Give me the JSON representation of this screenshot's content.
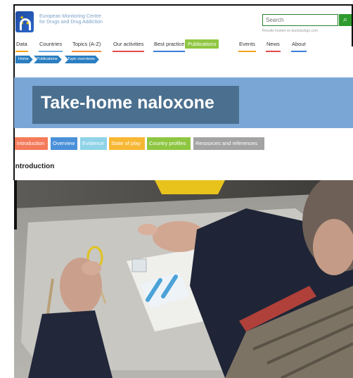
{
  "header": {
    "org_name_line1": "European Monitoring Centre",
    "org_name_line2": "for Drugs and Drug Addiction",
    "search_placeholder": "Search",
    "search_hint": "Results hosted on duckduckgo.com"
  },
  "nav": {
    "items": [
      {
        "label": "Data",
        "color": "#f4a21a"
      },
      {
        "label": "Countries",
        "color": "#6aa8e0"
      },
      {
        "label": "Topics (A-Z)",
        "color": "#f08a3c"
      },
      {
        "label": "Our activities",
        "color": "#e54b4b"
      },
      {
        "label": "Best practice",
        "color": "#3b7dd8"
      },
      {
        "label": "Publications",
        "color": "#8ec641"
      },
      {
        "label": "Events",
        "color": "#f4a21a"
      },
      {
        "label": "News",
        "color": "#e54b4b"
      },
      {
        "label": "About",
        "color": "#3b7dd8"
      }
    ]
  },
  "breadcrumb": [
    "Home",
    "Publications",
    "Topic overviews"
  ],
  "page_title": "Take-home naloxone",
  "tabs": [
    {
      "label": "Introduction",
      "color": "#f47a5a"
    },
    {
      "label": "Overview",
      "color": "#4a90d9"
    },
    {
      "label": "Evidence",
      "color": "#8fd3e8"
    },
    {
      "label": "State of play",
      "color": "#f7b733"
    },
    {
      "label": "Country profiles",
      "color": "#8ec641"
    },
    {
      "label": "Resources and references",
      "color": "#a3a3a3"
    }
  ],
  "section_heading": "Introduction",
  "colors": {
    "banner": "#7aa6d6",
    "title_box": "#4b6f8e",
    "breadcrumb": "#2a7ec1",
    "search_button": "#2e9b2e"
  }
}
